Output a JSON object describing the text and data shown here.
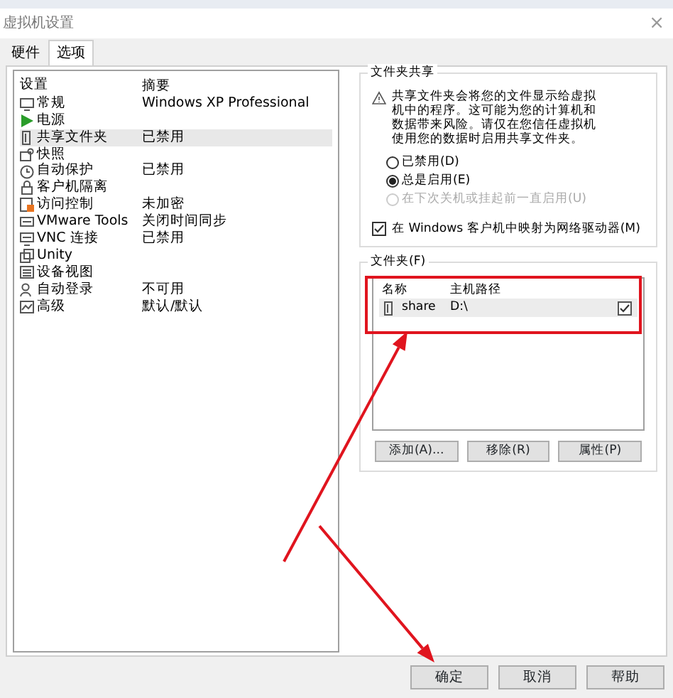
{
  "window": {
    "title": "虚拟机设置",
    "close": "×"
  },
  "tabs": [
    {
      "label": "硬件",
      "selected": false
    },
    {
      "label": "选项",
      "selected": true
    }
  ],
  "settings": {
    "columns": [
      "设置",
      "摘要"
    ],
    "rows": [
      {
        "name": "常规",
        "summary": "Windows XP Professional",
        "selected": false
      },
      {
        "name": "电源",
        "summary": "",
        "selected": false
      },
      {
        "name": "共享文件夹",
        "summary": "已禁用",
        "selected": true
      },
      {
        "name": "快照",
        "summary": "",
        "selected": false
      },
      {
        "name": "自动保护",
        "summary": "已禁用",
        "selected": false
      },
      {
        "name": "客户机隔离",
        "summary": "",
        "selected": false
      },
      {
        "name": "访问控制",
        "summary": "未加密",
        "selected": false
      },
      {
        "name": "VMware Tools",
        "summary": "关闭时间同步",
        "selected": false
      },
      {
        "name": "VNC 连接",
        "summary": "已禁用",
        "selected": false
      },
      {
        "name": "Unity",
        "summary": "",
        "selected": false
      },
      {
        "name": "设备视图",
        "summary": "",
        "selected": false
      },
      {
        "name": "自动登录",
        "summary": "不可用",
        "selected": false
      },
      {
        "name": "高级",
        "summary": "默认/默认",
        "selected": false
      }
    ]
  },
  "sharing": {
    "title": "文件夹共享",
    "warning": "共享文件夹会将您的文件显示给虚拟机中的程序。这可能为您的计算机和数据带来风险。请仅在您信任虚拟机使用您的数据时启用共享文件夹。",
    "options": [
      {
        "label": "已禁用(D)",
        "selected": false,
        "disabled": false
      },
      {
        "label": "总是启用(E)",
        "selected": true,
        "disabled": false
      },
      {
        "label": "在下次关机或挂起前一直启用(U)",
        "selected": false,
        "disabled": true
      }
    ],
    "map_drive": {
      "label": "在 Windows 客户机中映射为网络驱动器(M)",
      "checked": true
    }
  },
  "folders": {
    "title": "文件夹(F)",
    "columns": [
      "名称",
      "主机路径"
    ],
    "rows": [
      {
        "name": "share",
        "path": "D:\\",
        "enabled": true
      }
    ],
    "buttons": [
      "添加(A)...",
      "移除(R)",
      "属性(P)"
    ]
  },
  "footer_buttons": [
    "确定",
    "取消",
    "帮助"
  ],
  "annotations": [
    {
      "kind": "box"
    },
    {
      "kind": "arrow"
    },
    {
      "kind": "arrow"
    }
  ]
}
